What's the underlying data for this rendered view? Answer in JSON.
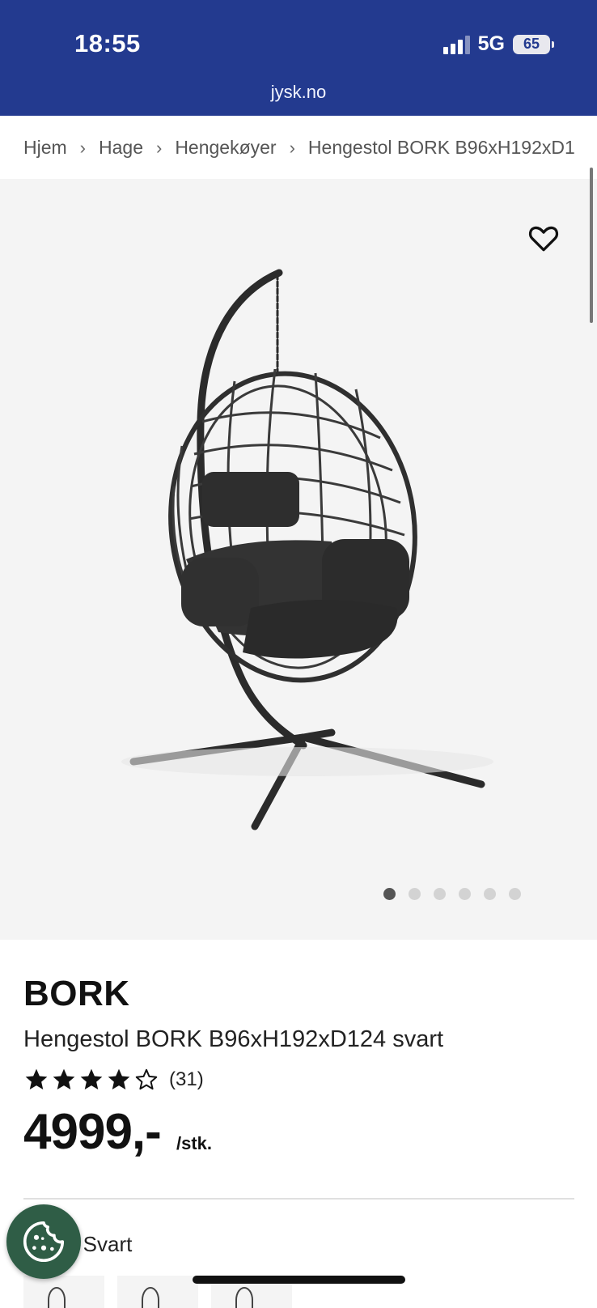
{
  "status_bar": {
    "time": "18:55",
    "network": "5G",
    "battery": "65"
  },
  "browser": {
    "url": "jysk.no"
  },
  "breadcrumb": [
    "Hjem",
    "Hage",
    "Hengekøyer",
    "Hengestol BORK B96xH192xD1"
  ],
  "gallery": {
    "image_count": 6,
    "active_index": 0,
    "favorite_icon": "heart-outline-icon"
  },
  "product": {
    "brand": "BORK",
    "name": "Hengestol BORK B96xH192xD124 svart",
    "rating": 4,
    "rating_max": 5,
    "review_count": "(31)",
    "price": "4999,-",
    "unit": "/stk.",
    "color_label": ":",
    "color_value": "Svart"
  },
  "colors": {
    "header_bg": "#233a8f",
    "cookie_bg": "#2f5d46"
  }
}
